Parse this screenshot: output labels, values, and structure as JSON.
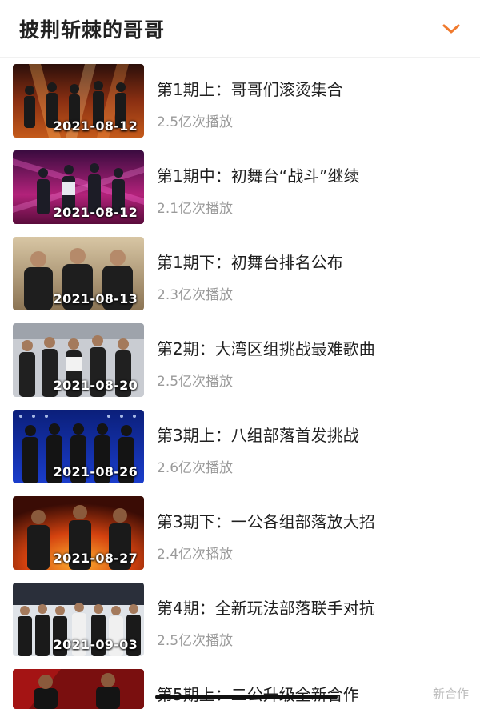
{
  "header": {
    "title": "披荆斩棘的哥哥"
  },
  "episodes": [
    {
      "title": "第1期上：哥哥们滚烫集合",
      "date": "2021-08-12",
      "plays": "2.5亿次播放",
      "theme": "stage-orange"
    },
    {
      "title": "第1期中：初舞台“战斗”继续",
      "date": "2021-08-12",
      "plays": "2.1亿次播放",
      "theme": "stage-pink"
    },
    {
      "title": "第1期下：初舞台排名公布",
      "date": "2021-08-13",
      "plays": "2.3亿次播放",
      "theme": "stage-beige"
    },
    {
      "title": "第2期：大湾区组挑战最难歌曲",
      "date": "2021-08-20",
      "plays": "2.5亿次播放",
      "theme": "stage-grey"
    },
    {
      "title": "第3期上：八组部落首发挑战",
      "date": "2021-08-26",
      "plays": "2.6亿次播放",
      "theme": "stage-blue"
    },
    {
      "title": "第3期下：一公各组部落放大招",
      "date": "2021-08-27",
      "plays": "2.4亿次播放",
      "theme": "stage-fire"
    },
    {
      "title": "第4期：全新玩法部落联手对抗",
      "date": "2021-09-03",
      "plays": "2.5亿次播放",
      "theme": "stage-white"
    },
    {
      "title": "第5期上：二公升级全新合作",
      "date": "",
      "plays": "",
      "theme": "stage-red"
    }
  ],
  "watermark": "新合作"
}
